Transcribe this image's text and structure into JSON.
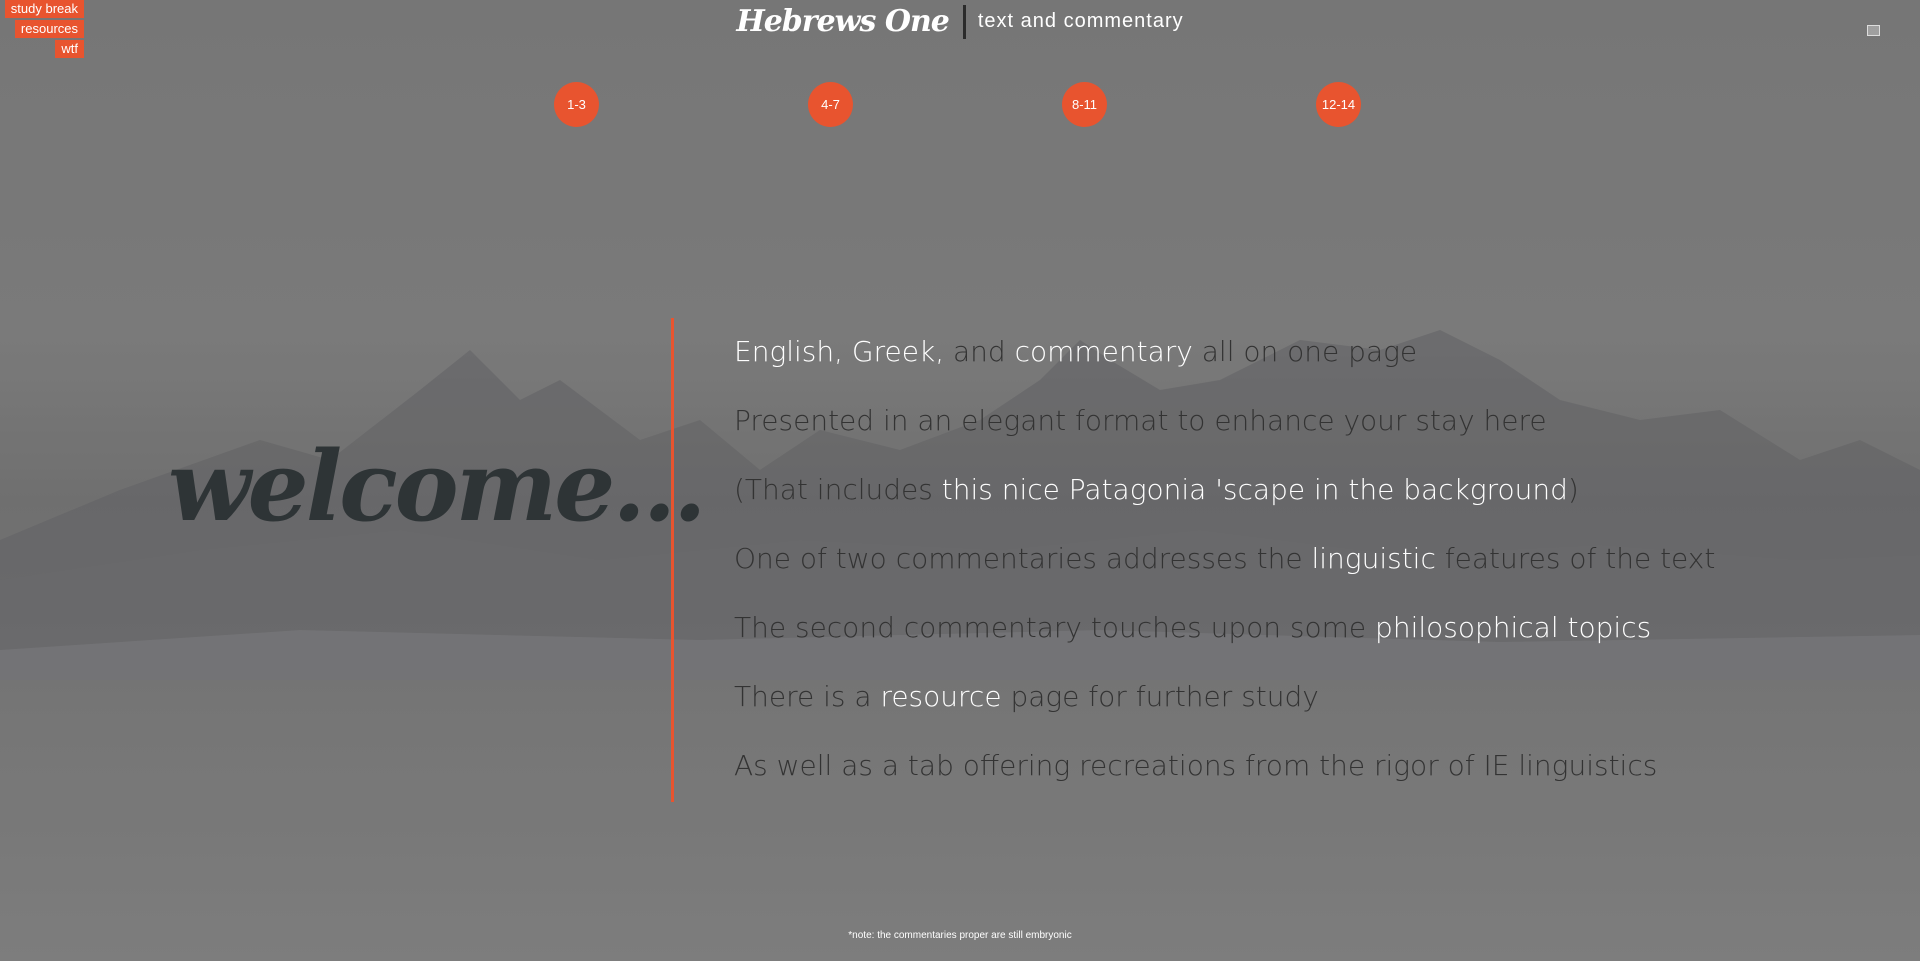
{
  "tabs": [
    "study break",
    "resources",
    "wtf"
  ],
  "header": {
    "brand": "Hebrews One",
    "subtitle": "text and commentary"
  },
  "chapters": [
    "1-3",
    "4-7",
    "8-11",
    "12-14"
  ],
  "welcome": "welcome...",
  "features": [
    [
      {
        "t": "English, Greek,",
        "h": true
      },
      {
        "t": " and ",
        "h": false
      },
      {
        "t": "commentary",
        "h": true
      },
      {
        "t": " all on one page",
        "h": false
      }
    ],
    [
      {
        "t": "Presented in an elegant format to enhance your stay here",
        "h": false
      }
    ],
    [
      {
        "t": "(That includes ",
        "h": false
      },
      {
        "t": "this nice Patagonia 'scape in the background",
        "h": true
      },
      {
        "t": ")",
        "h": false
      }
    ],
    [
      {
        "t": "One of two commentaries addresses the ",
        "h": false
      },
      {
        "t": "linguistic",
        "h": true
      },
      {
        "t": " features of the text",
        "h": false
      }
    ],
    [
      {
        "t": "The second commentary touches upon some ",
        "h": false
      },
      {
        "t": "philosophical topics",
        "h": true
      }
    ],
    [
      {
        "t": "There is a ",
        "h": false
      },
      {
        "t": "resource",
        "h": true
      },
      {
        "t": " page for further study",
        "h": false
      }
    ],
    [
      {
        "t": "As well as a tab offering recreations from the rigor of IE linguistics",
        "h": false
      }
    ]
  ],
  "footnote": "*note: the commentaries proper are still embryonic",
  "colors": {
    "accent": "#e8542f",
    "welcome": "#2e3436",
    "text": "#333333",
    "highlight": "#ffffff"
  }
}
